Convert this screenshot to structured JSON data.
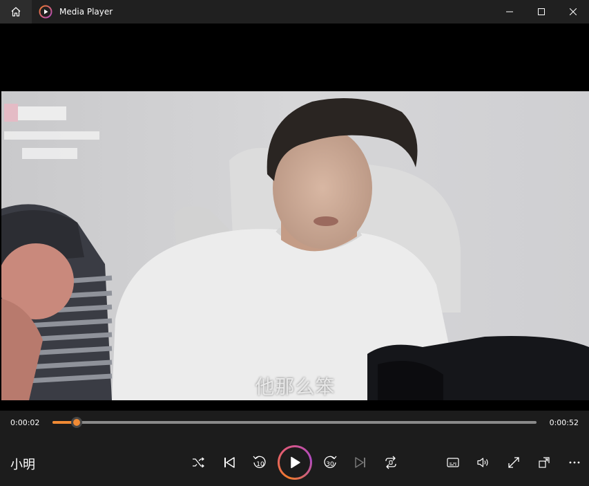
{
  "window": {
    "title": "Media Player",
    "icons": {
      "home": "home-icon",
      "app": "media-player-icon",
      "minimize": "minimize-icon",
      "maximize": "maximize-icon",
      "close": "close-icon"
    }
  },
  "video": {
    "subtitle": "他那么笨"
  },
  "seek": {
    "elapsed": "0:00:02",
    "total": "0:00:52",
    "progress": 0.05
  },
  "controls": {
    "track_title": "小明",
    "skip_back_seconds": "10",
    "skip_forward_seconds": "30",
    "icons": [
      "shuffle-icon",
      "previous-icon",
      "skip-back-10-icon",
      "play-icon",
      "skip-forward-30-icon",
      "next-icon",
      "repeat-icon",
      "subtitles-icon",
      "volume-icon",
      "fullscreen-icon",
      "mini-player-icon",
      "more-icon"
    ]
  },
  "colors": {
    "accent": "#f08a34",
    "background": "#202020"
  }
}
